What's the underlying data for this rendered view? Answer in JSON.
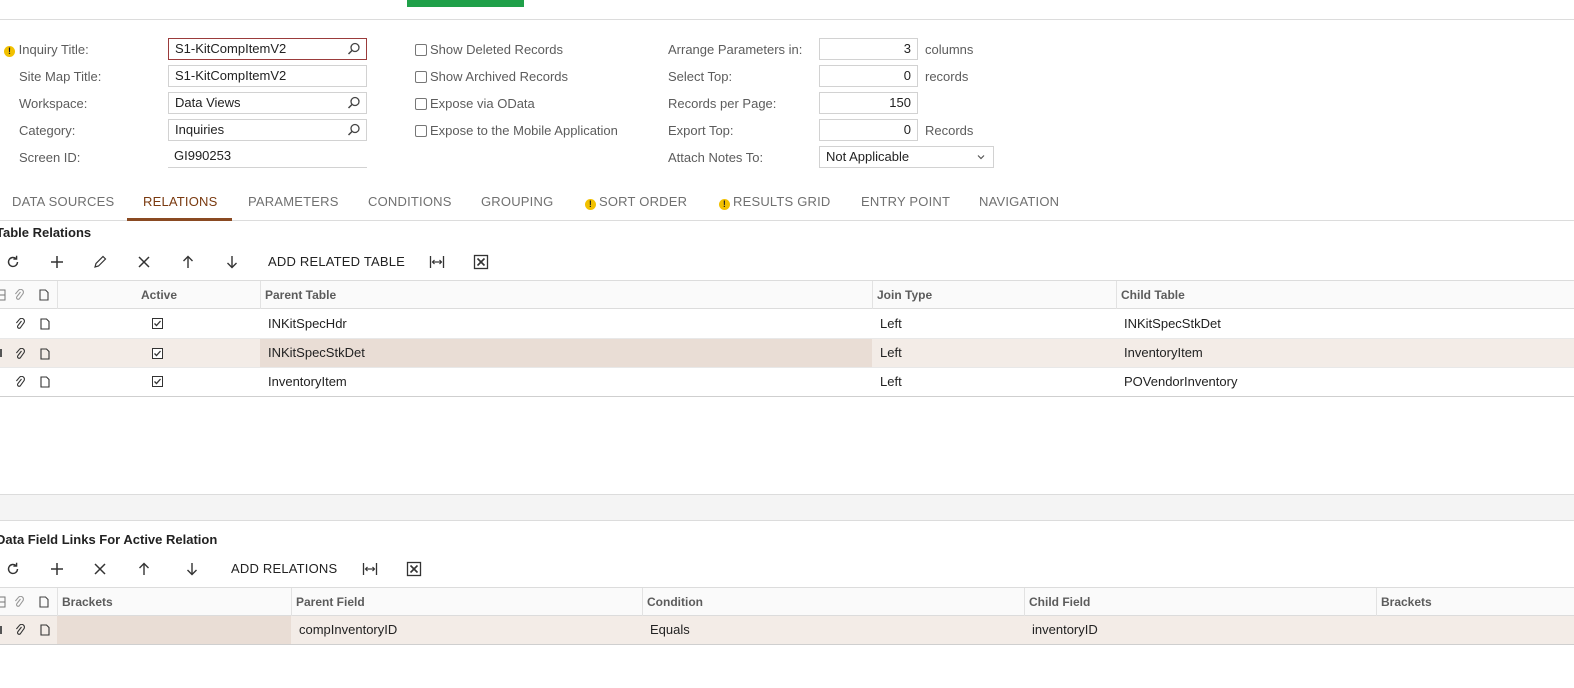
{
  "form": {
    "inquiry_title_label": "Inquiry Title:",
    "inquiry_title_value": "S1-KitCompItemV2",
    "site_map_title_label": "Site Map Title:",
    "site_map_title_value": "S1-KitCompItemV2",
    "workspace_label": "Workspace:",
    "workspace_value": "Data Views",
    "category_label": "Category:",
    "category_value": "Inquiries",
    "screen_id_label": "Screen ID:",
    "screen_id_value": "GI990253",
    "show_deleted": "Show Deleted Records",
    "show_archived": "Show Archived Records",
    "expose_odata": "Expose via OData",
    "expose_mobile": "Expose to the Mobile Application",
    "arrange_label": "Arrange Parameters in:",
    "arrange_value": "3",
    "arrange_suffix": "columns",
    "select_top_label": "Select Top:",
    "select_top_value": "0",
    "select_top_suffix": "records",
    "records_per_page_label": "Records per Page:",
    "records_per_page_value": "150",
    "export_top_label": "Export Top:",
    "export_top_value": "0",
    "export_top_suffix": "Records",
    "attach_notes_label": "Attach Notes To:",
    "attach_notes_value": "Not Applicable"
  },
  "tabs": [
    {
      "label": "DATA SOURCES"
    },
    {
      "label": "RELATIONS"
    },
    {
      "label": "PARAMETERS"
    },
    {
      "label": "CONDITIONS"
    },
    {
      "label": "GROUPING"
    },
    {
      "label": "SORT ORDER"
    },
    {
      "label": "RESULTS GRID"
    },
    {
      "label": "ENTRY POINT"
    },
    {
      "label": "NAVIGATION"
    }
  ],
  "relations": {
    "title": "Table Relations",
    "add_label": "ADD RELATED TABLE",
    "headers": {
      "active": "Active",
      "parent": "Parent Table",
      "join": "Join Type",
      "child": "Child Table"
    },
    "rows": [
      {
        "active": true,
        "parent": "INKitSpecHdr",
        "join": "Left",
        "child": "INKitSpecStkDet"
      },
      {
        "active": true,
        "parent": "INKitSpecStkDet",
        "join": "Left",
        "child": "InventoryItem"
      },
      {
        "active": true,
        "parent": "InventoryItem",
        "join": "Left",
        "child": "POVendorInventory"
      }
    ]
  },
  "links": {
    "title": "Data Field Links For Active Relation",
    "add_label": "ADD RELATIONS",
    "headers": {
      "brackets1": "Brackets",
      "parent": "Parent Field",
      "condition": "Condition",
      "child": "Child Field",
      "brackets2": "Brackets"
    },
    "rows": [
      {
        "brackets1": "",
        "parent": "compInventoryID",
        "condition": "Equals",
        "child": "inventoryID",
        "brackets2": ""
      }
    ]
  },
  "colors": {
    "accent": "#8a4a22",
    "brand_green": "#1fa049",
    "warning": "#f2c100",
    "selected_row": "#f3ece7"
  }
}
